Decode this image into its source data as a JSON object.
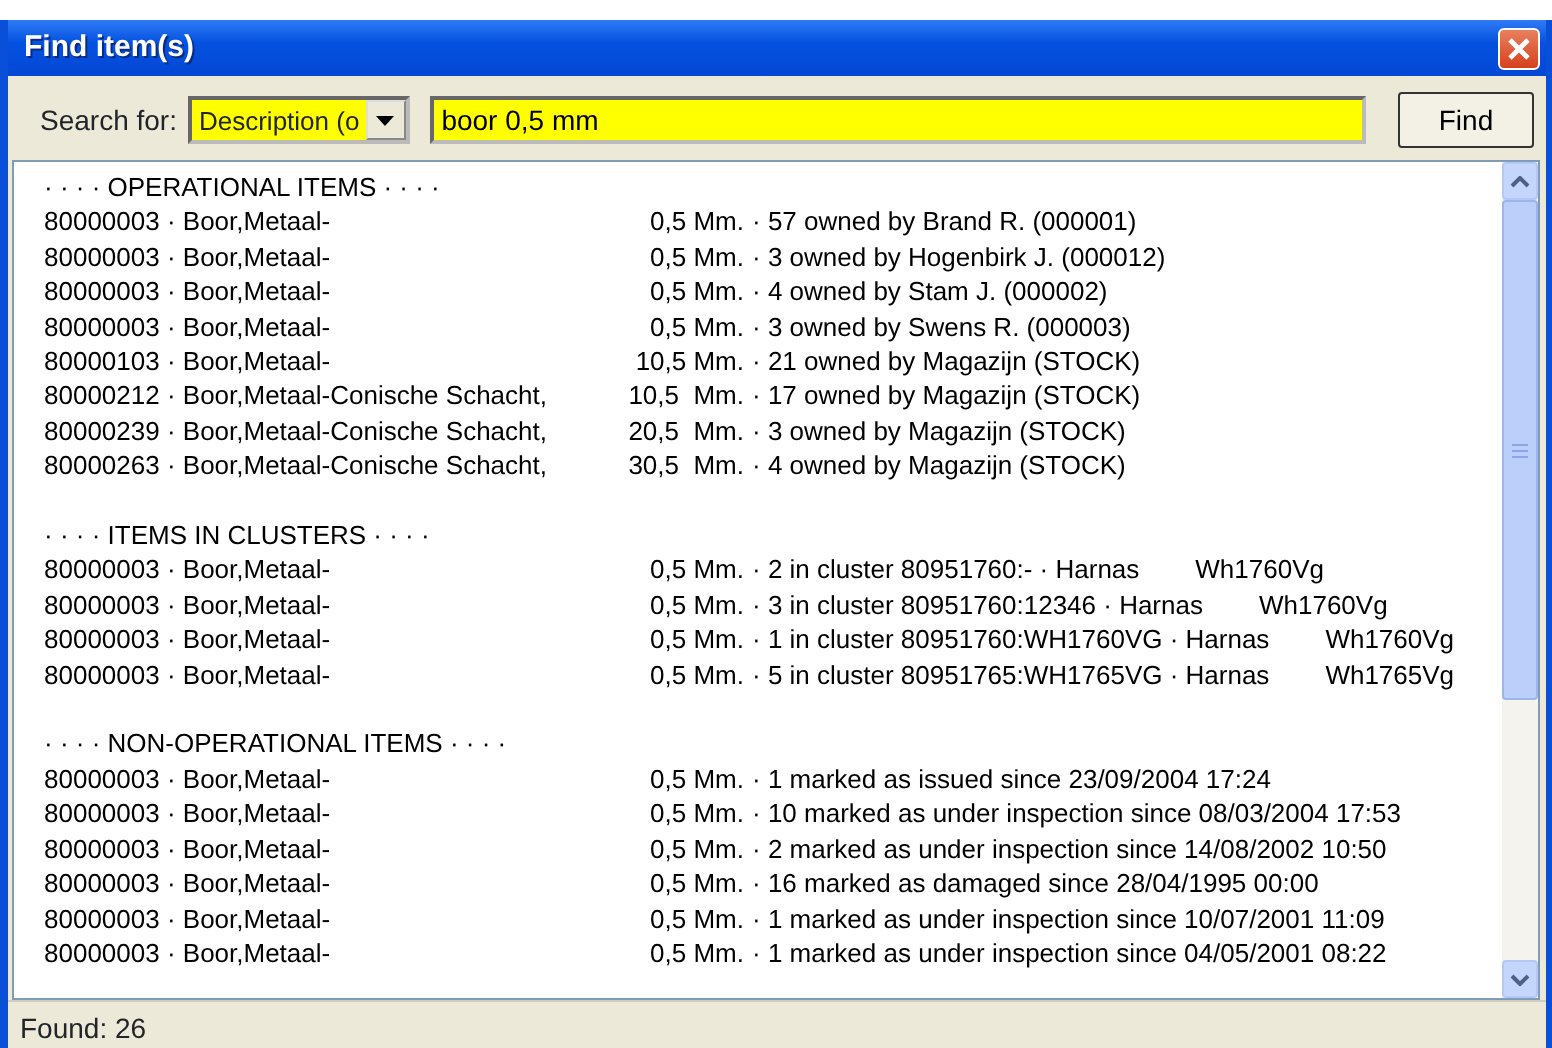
{
  "window": {
    "title": "Find item(s)"
  },
  "search": {
    "label": "Search for:",
    "field": "Description (o",
    "query": "boor 0,5 mm",
    "button": "Find"
  },
  "sections": [
    {
      "title": "· · · · OPERATIONAL ITEMS · · · ·",
      "rows": [
        {
          "item": "80000003 · Boor,Metaal-",
          "size": "0,5 Mm.",
          "detail": "· 57 owned by Brand R. (000001)"
        },
        {
          "item": "80000003 · Boor,Metaal-",
          "size": "0,5 Mm.",
          "detail": "· 3 owned by Hogenbirk J. (000012)"
        },
        {
          "item": "80000003 · Boor,Metaal-",
          "size": "0,5 Mm.",
          "detail": "· 4 owned by Stam J. (000002)"
        },
        {
          "item": "80000003 · Boor,Metaal-",
          "size": "0,5 Mm.",
          "detail": "· 3 owned by Swens R. (000003)"
        },
        {
          "item": "80000103 · Boor,Metaal-",
          "size": "10,5 Mm.",
          "detail": "· 21 owned by Magazijn (STOCK)"
        },
        {
          "item": "80000212 · Boor,Metaal-Conische Schacht,",
          "size": "10,5  Mm.",
          "detail": "· 17 owned by Magazijn (STOCK)"
        },
        {
          "item": "80000239 · Boor,Metaal-Conische Schacht,",
          "size": "20,5  Mm.",
          "detail": "· 3 owned by Magazijn (STOCK)"
        },
        {
          "item": "80000263 · Boor,Metaal-Conische Schacht,",
          "size": "30,5  Mm.",
          "detail": "· 4 owned by Magazijn (STOCK)"
        }
      ]
    },
    {
      "title": "· · · · ITEMS IN CLUSTERS · · · ·",
      "rows": [
        {
          "item": "80000003 · Boor,Metaal-",
          "size": "0,5 Mm.",
          "detail": "· 2 in cluster 80951760:- · Harnas",
          "tail": "Wh1760Vg"
        },
        {
          "item": "80000003 · Boor,Metaal-",
          "size": "0,5 Mm.",
          "detail": "· 3 in cluster 80951760:12346 · Harnas",
          "tail": "Wh1760Vg"
        },
        {
          "item": "80000003 · Boor,Metaal-",
          "size": "0,5 Mm.",
          "detail": "· 1 in cluster 80951760:WH1760VG · Harnas",
          "tail": "Wh1760Vg"
        },
        {
          "item": "80000003 · Boor,Metaal-",
          "size": "0,5 Mm.",
          "detail": "· 5 in cluster 80951765:WH1765VG · Harnas",
          "tail": "Wh1765Vg"
        }
      ]
    },
    {
      "title": "· · · · NON-OPERATIONAL ITEMS · · · ·",
      "rows": [
        {
          "item": "80000003 · Boor,Metaal-",
          "size": "0,5 Mm.",
          "detail": "· 1 marked as issued since 23/09/2004 17:24"
        },
        {
          "item": "80000003 · Boor,Metaal-",
          "size": "0,5 Mm.",
          "detail": "· 10 marked as under inspection since 08/03/2004 17:53"
        },
        {
          "item": "80000003 · Boor,Metaal-",
          "size": "0,5 Mm.",
          "detail": "· 2 marked as under inspection since 14/08/2002 10:50"
        },
        {
          "item": "80000003 · Boor,Metaal-",
          "size": "0,5 Mm.",
          "detail": "· 16 marked as damaged since 28/04/1995 00:00"
        },
        {
          "item": "80000003 · Boor,Metaal-",
          "size": "0,5 Mm.",
          "detail": "· 1 marked as under inspection since 10/07/2001 11:09"
        },
        {
          "item": "80000003 · Boor,Metaal-",
          "size": "0,5 Mm.",
          "detail": "· 1 marked as under inspection since 04/05/2001 08:22"
        }
      ]
    }
  ],
  "status_bar": "Found: 26"
}
